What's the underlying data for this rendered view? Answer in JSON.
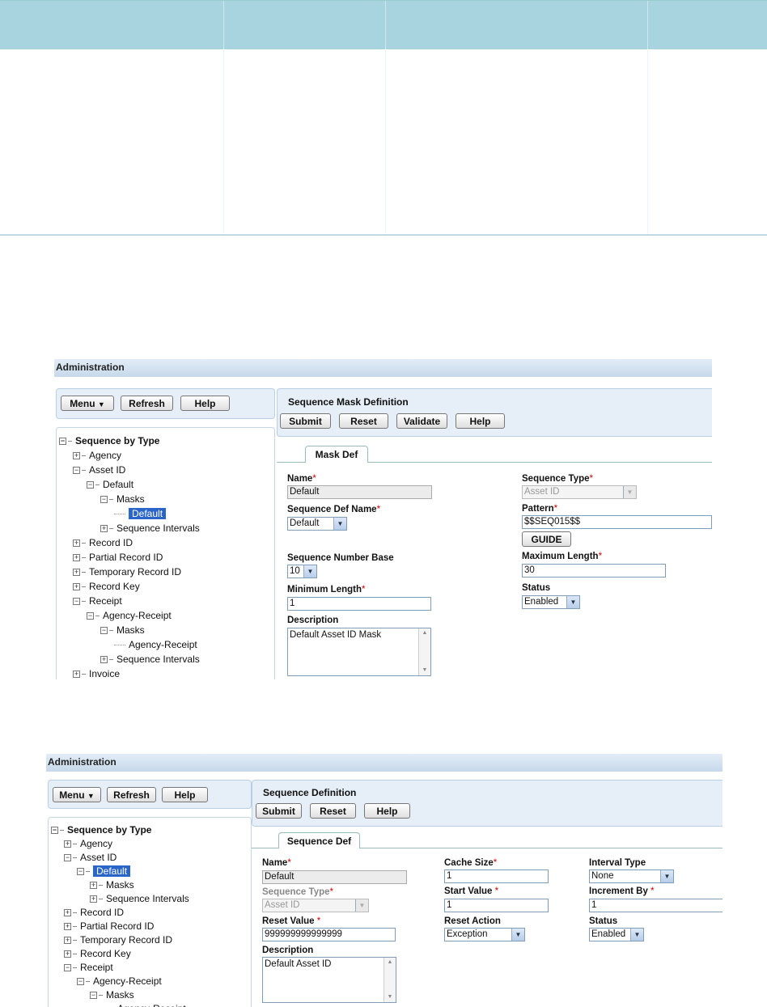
{
  "shot1": {
    "admin_title": "Administration",
    "left_buttons": {
      "menu": "Menu",
      "refresh": "Refresh",
      "help": "Help"
    },
    "tree": [
      {
        "label": "Sequence by Type",
        "level": 0,
        "expander": "minus"
      },
      {
        "label": "Agency",
        "level": 1,
        "expander": "plus"
      },
      {
        "label": "Asset ID",
        "level": 1,
        "expander": "minus"
      },
      {
        "label": "Default",
        "level": 2,
        "expander": "minus"
      },
      {
        "label": "Masks",
        "level": 3,
        "expander": "minus"
      },
      {
        "label": "Default",
        "level": 4,
        "expander": "none",
        "selected": true
      },
      {
        "label": "Sequence Intervals",
        "level": 3,
        "expander": "plus"
      },
      {
        "label": "Record ID",
        "level": 1,
        "expander": "plus"
      },
      {
        "label": "Partial Record ID",
        "level": 1,
        "expander": "plus"
      },
      {
        "label": "Temporary Record ID",
        "level": 1,
        "expander": "plus"
      },
      {
        "label": "Record Key",
        "level": 1,
        "expander": "plus"
      },
      {
        "label": "Receipt",
        "level": 1,
        "expander": "minus"
      },
      {
        "label": "Agency-Receipt",
        "level": 2,
        "expander": "minus"
      },
      {
        "label": "Masks",
        "level": 3,
        "expander": "minus"
      },
      {
        "label": "Agency-Receipt",
        "level": 4,
        "expander": "none"
      },
      {
        "label": "Sequence Intervals",
        "level": 3,
        "expander": "plus"
      },
      {
        "label": "Invoice",
        "level": 1,
        "expander": "plus"
      }
    ],
    "panel_title": "Sequence Mask Definition",
    "panel_buttons": {
      "submit": "Submit",
      "reset": "Reset",
      "validate": "Validate",
      "help": "Help"
    },
    "tab": "Mask Def",
    "form": {
      "name_label": "Name",
      "name_value": "Default",
      "seq_def_name_label": "Sequence Def Name",
      "seq_def_name_value": "Default",
      "seq_number_base_label": "Sequence Number Base",
      "seq_number_base_value": "10",
      "min_length_label": "Minimum Length",
      "min_length_value": "1",
      "description_label": "Description",
      "description_value": "Default Asset ID Mask",
      "seq_type_label": "Sequence Type",
      "seq_type_value": "Asset ID",
      "pattern_label": "Pattern",
      "pattern_value": "$$SEQ015$$",
      "guide_button": "GUIDE",
      "max_length_label": "Maximum Length",
      "max_length_value": "30",
      "status_label": "Status",
      "status_value": "Enabled"
    }
  },
  "shot2": {
    "admin_title": "Administration",
    "left_buttons": {
      "menu": "Menu",
      "refresh": "Refresh",
      "help": "Help"
    },
    "tree": [
      {
        "label": "Sequence by Type",
        "level": 0,
        "expander": "minus"
      },
      {
        "label": "Agency",
        "level": 1,
        "expander": "plus"
      },
      {
        "label": "Asset ID",
        "level": 1,
        "expander": "minus"
      },
      {
        "label": "Default",
        "level": 2,
        "expander": "minus",
        "selected": true
      },
      {
        "label": "Masks",
        "level": 3,
        "expander": "plus"
      },
      {
        "label": "Sequence Intervals",
        "level": 3,
        "expander": "plus"
      },
      {
        "label": "Record ID",
        "level": 1,
        "expander": "plus"
      },
      {
        "label": "Partial Record ID",
        "level": 1,
        "expander": "plus"
      },
      {
        "label": "Temporary Record ID",
        "level": 1,
        "expander": "plus"
      },
      {
        "label": "Record Key",
        "level": 1,
        "expander": "plus"
      },
      {
        "label": "Receipt",
        "level": 1,
        "expander": "minus"
      },
      {
        "label": "Agency-Receipt",
        "level": 2,
        "expander": "minus"
      },
      {
        "label": "Masks",
        "level": 3,
        "expander": "minus"
      },
      {
        "label": "Agency-Receipt",
        "level": 4,
        "expander": "none"
      }
    ],
    "panel_title": "Sequence Definition",
    "panel_buttons": {
      "submit": "Submit",
      "reset": "Reset",
      "help": "Help"
    },
    "tab": "Sequence Def",
    "form": {
      "name_label": "Name",
      "name_value": "Default",
      "seq_type_label": "Sequence Type",
      "seq_type_value": "Asset ID",
      "reset_value_label": "Reset Value",
      "reset_value_value": "999999999999999",
      "description_label": "Description",
      "description_value": "Default Asset ID",
      "cache_size_label": "Cache Size",
      "cache_size_value": "1",
      "start_value_label": "Start Value",
      "start_value_value": "1",
      "reset_action_label": "Reset Action",
      "reset_action_value": "Exception",
      "interval_type_label": "Interval Type",
      "interval_type_value": "None",
      "increment_by_label": "Increment By",
      "increment_by_value": "1",
      "status_label": "Status",
      "status_value": "Enabled"
    }
  }
}
